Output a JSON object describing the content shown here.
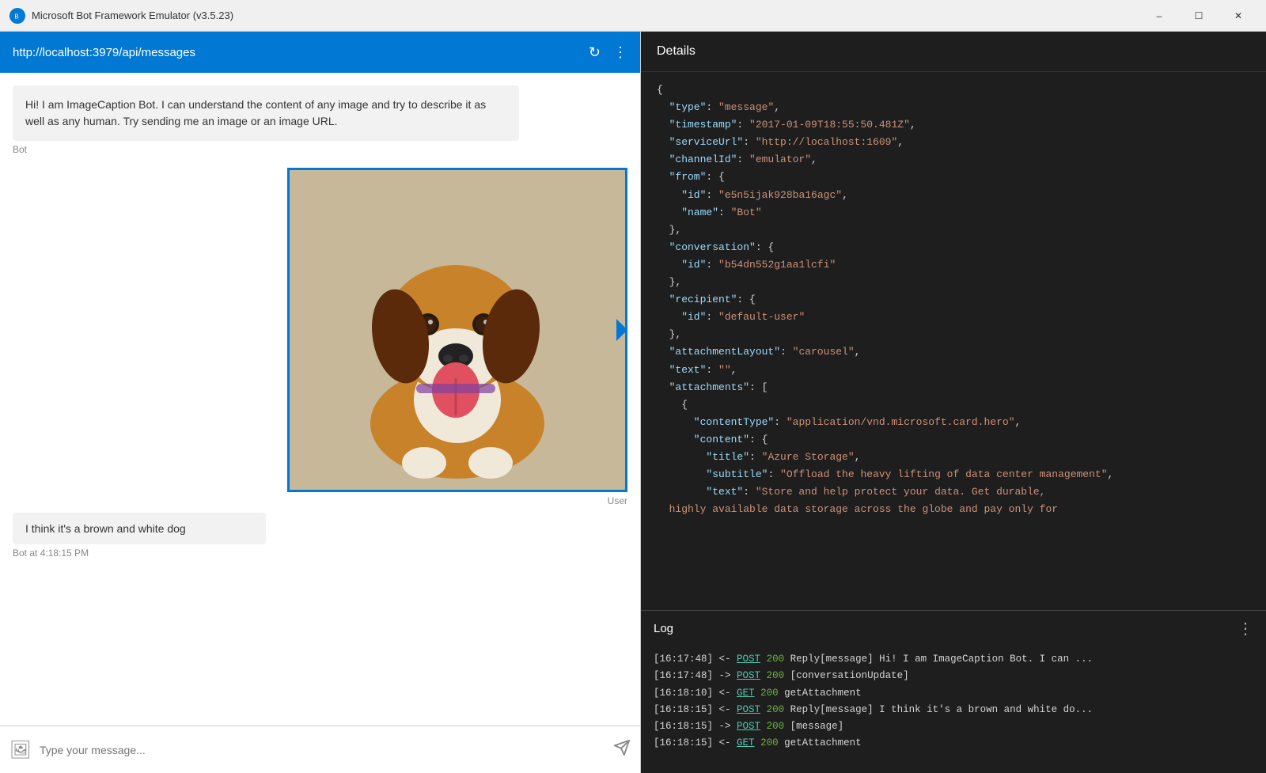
{
  "titleBar": {
    "title": "Microsoft Bot Framework Emulator (v3.5.23)",
    "minimizeLabel": "–",
    "maximizeLabel": "☐",
    "closeLabel": "✕"
  },
  "chatHeader": {
    "url": "http://localhost:3979/api/messages",
    "refreshIcon": "↻",
    "menuIcon": "⋮"
  },
  "botIntroMessage": "Hi! I am ImageCaption Bot. I can understand the content of any image and try to describe it as well as any human. Try sending me an image or an image URL.",
  "botSender": "Bot",
  "userLabel": "User",
  "botReplyMessage": "I think it's a brown and white dog",
  "botReplyTimestamp": "Bot at 4:18:15 PM",
  "chatInputPlaceholder": "Type your message...",
  "details": {
    "headerLabel": "Details",
    "json": [
      {
        "line": "{"
      },
      {
        "key": "  \"type\"",
        "value": "\"message\","
      },
      {
        "key": "  \"timestamp\"",
        "value": "\"2017-01-09T18:55:50.481Z\","
      },
      {
        "key": "  \"serviceUrl\"",
        "value": "\"http://localhost:1609\","
      },
      {
        "key": "  \"channelId\"",
        "value": "\"emulator\","
      },
      {
        "key": "  \"from\"",
        "value": "{"
      },
      {
        "key": "    \"id\"",
        "value": "\"e5n5ijak928ba16agc\","
      },
      {
        "key": "    \"name\"",
        "value": "\"Bot\""
      },
      {
        "line": "  },"
      },
      {
        "key": "  \"conversation\"",
        "value": "{"
      },
      {
        "key": "    \"id\"",
        "value": "\"b54dn552g1aa1lcfi\""
      },
      {
        "line": "  },"
      },
      {
        "key": "  \"recipient\"",
        "value": "{"
      },
      {
        "key": "    \"id\"",
        "value": "\"default-user\""
      },
      {
        "line": "  },"
      },
      {
        "key": "  \"attachmentLayout\"",
        "value": "\"carousel\","
      },
      {
        "key": "  \"text\"",
        "value": "\"\","
      },
      {
        "key": "  \"attachments\"",
        "value": "["
      },
      {
        "line": "    {"
      },
      {
        "key": "      \"contentType\"",
        "value": "\"application/vnd.microsoft.card.hero\","
      },
      {
        "key": "      \"content\"",
        "value": "{"
      },
      {
        "key": "        \"title\"",
        "value": "\"Azure Storage\","
      },
      {
        "key": "        \"subtitle\"",
        "value": "\"Offload the heavy lifting of data center management\","
      },
      {
        "key": "        \"text\"",
        "value": "\"Store and help protect your data. Get durable, highly available data storage across the globe and pay only for"
      }
    ]
  },
  "log": {
    "headerLabel": "Log",
    "menuIcon": "⋮",
    "entries": [
      {
        "time": "[16:17:48]",
        "arrow": "<-",
        "method": "POST",
        "status": "200",
        "desc": "Reply[message] Hi! I am ImageCaption Bot. I can ..."
      },
      {
        "time": "[16:17:48]",
        "arrow": "->",
        "method": "POST",
        "status": "200",
        "desc": "[conversationUpdate]"
      },
      {
        "time": "[16:18:10]",
        "arrow": "<-",
        "method": "GET",
        "status": "200",
        "desc": "getAttachment"
      },
      {
        "time": "[16:18:15]",
        "arrow": "<-",
        "method": "POST",
        "status": "200",
        "desc": "Reply[message] I think it's a brown and white do..."
      },
      {
        "time": "[16:18:15]",
        "arrow": "->",
        "method": "POST",
        "status": "200",
        "desc": "[message]"
      },
      {
        "time": "[16:18:15]",
        "arrow": "<-",
        "method": "GET",
        "status": "200",
        "desc": "getAttachment"
      }
    ]
  }
}
